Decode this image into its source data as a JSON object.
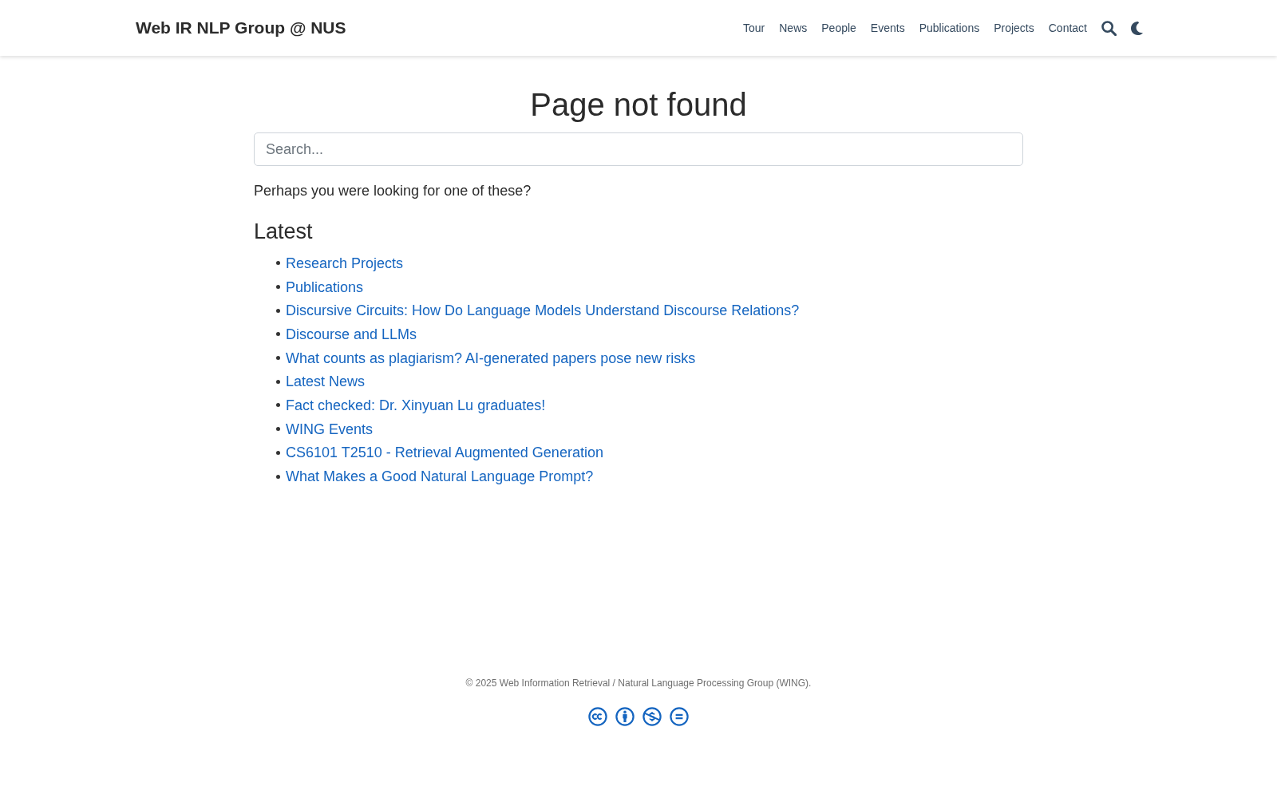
{
  "header": {
    "brand": "Web IR NLP Group @ NUS",
    "nav": [
      "Tour",
      "News",
      "People",
      "Events",
      "Publications",
      "Projects",
      "Contact"
    ]
  },
  "main": {
    "title": "Page not found",
    "search": {
      "placeholder": "Search..."
    },
    "prompt": "Perhaps you were looking for one of these?",
    "latest": {
      "heading": "Latest",
      "links": [
        "Research Projects",
        "Publications",
        "Discursive Circuits: How Do Language Models Understand Discourse Relations?",
        "Discourse and LLMs",
        "What counts as plagiarism? AI-generated papers pose new risks",
        "Latest News",
        "Fact checked: Dr. Xinyuan Lu graduates!",
        "WING Events",
        "CS6101 T2510 - Retrieval Augmented Generation",
        "What Makes a Good Natural Language Prompt?"
      ]
    }
  },
  "footer": {
    "copyright": "© 2025 Web Information Retrieval / Natural Language Processing Group (WING)."
  }
}
